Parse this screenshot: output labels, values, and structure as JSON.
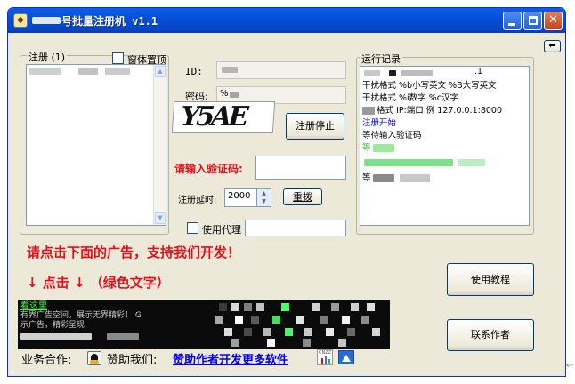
{
  "window": {
    "title": "号批量注册机   v1.1",
    "app_icon": "app-icon",
    "buttons": [
      "minimize-icon",
      "maximize-icon",
      "close-icon"
    ]
  },
  "left_panel": {
    "group_label": "注册 (1)",
    "checkbox_label": "窗体置顶"
  },
  "form": {
    "id_label": "ID:",
    "password_label": "密码:",
    "password_value": "%",
    "captcha_text": "Y5AE",
    "stop_button": "注册停止",
    "captcha_prompt": "请输入验证码:",
    "delay_label": "注册延时:",
    "delay_value": "2000",
    "retry_button": "重拨",
    "proxy_label": "使用代理"
  },
  "log": {
    "group_label": "运行记录",
    "collapse_icon": "arrow-left-icon",
    "version_fragment": ".1",
    "lines": [
      "干扰格式  %b小写英文 %B大写英文",
      "干扰格式  %i数字 %c汉字",
      "格式  IP:端口   例 127.0.0.1:8000",
      "注册开始",
      "等待输入验证码",
      "等",
      "等"
    ],
    "colors": {
      "accent": "#0000cc",
      "highlight_green": "#58e070"
    }
  },
  "promo": {
    "line1": "请点击下面的广告，支持我们开发！",
    "line2": "↓ 点击 ↓ （绿色文字）",
    "color": "#e0101a"
  },
  "ad": {
    "headline": "看这里",
    "text1": "有界广告空间，展示无界精彩！ G",
    "text2": "示广告，精彩呈现"
  },
  "bottom": {
    "business_label": "业务合作:",
    "sponsor_label": "赞助我们:",
    "sponsor_link": "赞助作者开发更多软件",
    "cnzz_label": "CNZZ",
    "qq_icon": "qq-icon",
    "stats_icon": "stats-icon",
    "image_icon": "image-icon"
  },
  "side_buttons": {
    "tutorial": "使用教程",
    "contact": "联系作者"
  }
}
